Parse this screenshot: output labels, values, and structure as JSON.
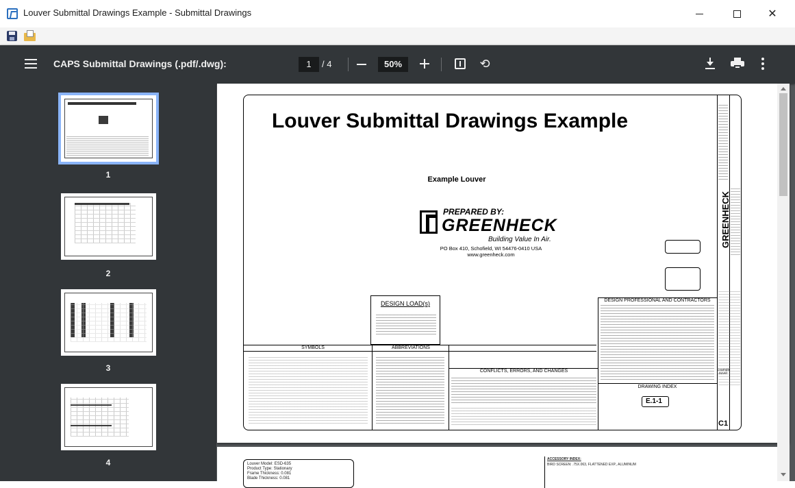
{
  "window": {
    "title": "Louver Submittal Drawings Example - Submittal Drawings",
    "minimize_label": "—",
    "maximize_label": "☐",
    "close_label": "✕"
  },
  "app_toolbar": {
    "save_icon": "save-icon",
    "open_icon": "open-folder-icon"
  },
  "viewer": {
    "document_title": "CAPS Submittal Drawings (.pdf/.dwg):",
    "current_page": "1",
    "total_pages": "/ 4",
    "zoom": "50%",
    "icons": [
      "menu-icon",
      "zoom-out-icon",
      "zoom-in-icon",
      "fit-page-icon",
      "rotate-icon",
      "download-icon",
      "print-icon",
      "more-icon"
    ]
  },
  "thumbnails": [
    {
      "number": "1",
      "selected": true
    },
    {
      "number": "2",
      "selected": false
    },
    {
      "number": "3",
      "selected": false
    },
    {
      "number": "4",
      "selected": false
    }
  ],
  "page": {
    "title": "Louver Submittal Drawings Example",
    "subtitle": "Example Louver",
    "prepared_by": "PREPARED BY:",
    "brand": "GREENHECK",
    "tagline": "Building Value In Air.",
    "address_line1": "PO Box 410, Schofield, WI 54476-0410 USA",
    "address_line2": "www.greenheck.com",
    "design_load_title": "DESIGN LOAD(s)",
    "symbols_title": "SYMBOLS",
    "abbreviations_title": "ABBREVIATIONS",
    "conflicts_title": "CONFLICTS, ERRORS, AND CHANGES",
    "design_professional_title": "DESIGN PROFESSIONAL AND CONTRACTORS",
    "drawing_index_title": "DRAWING INDEX",
    "drawing_index_sheet": "E.1-1",
    "sheet_number": "C1",
    "vertical_brand": "GREENHECK",
    "example_label": "Example Louver"
  },
  "page2": {
    "model": "Louver Model: ESD-635",
    "product_type": "Product Type: Stationary",
    "frame_thickness": "Frame Thickness: 0.081",
    "blade_thickness": "Blade Thickness: 0.081",
    "accessory_index": "ACCESSORY INDEX:",
    "accessory_line": "BIRD SCREEN: .75X.063, FLATTENED EXP., ALUMINUM"
  }
}
